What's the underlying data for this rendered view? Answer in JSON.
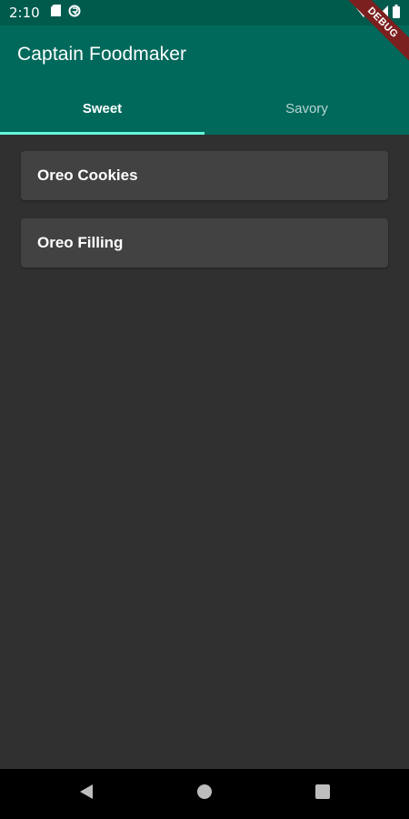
{
  "status_bar": {
    "time": "2:10",
    "icons_left": [
      "sd-card-icon",
      "circular-sync-icon"
    ],
    "icons_right": [
      "wifi-icon",
      "signal-icon",
      "battery-icon"
    ]
  },
  "app_bar": {
    "title": "Captain Foodmaker",
    "background_color": "#00695c",
    "tabs": [
      {
        "label": "Sweet",
        "selected": true
      },
      {
        "label": "Savory",
        "selected": false
      }
    ],
    "indicator_color": "#64ffda"
  },
  "debug_banner": {
    "label": "DEBUG"
  },
  "recipes": [
    {
      "name": "Oreo Cookies"
    },
    {
      "name": "Oreo Filling"
    }
  ],
  "nav_bar": {
    "buttons": [
      "back-icon",
      "home-icon",
      "recents-icon"
    ]
  }
}
